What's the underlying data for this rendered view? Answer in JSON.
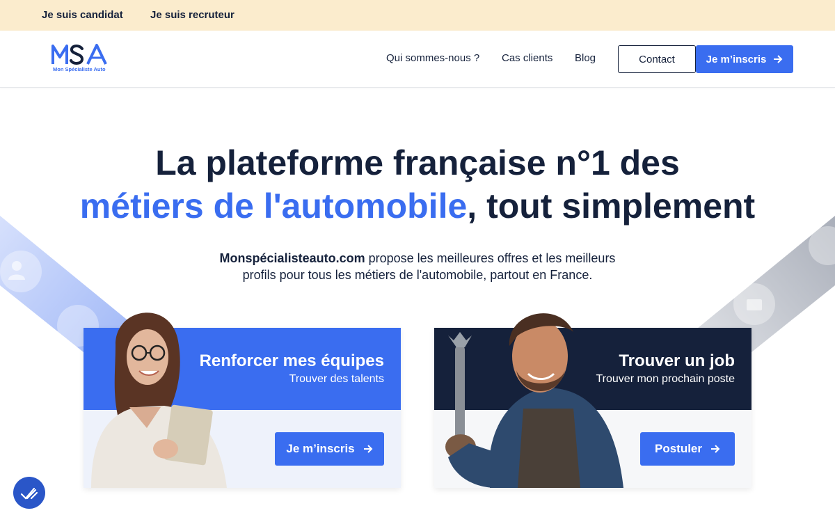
{
  "topbar": {
    "candidate_link": "Je suis candidat",
    "recruiter_link": "Je suis recruteur"
  },
  "header": {
    "logo_text": "MSA",
    "logo_tagline": "Mon Spécialiste Auto",
    "nav": [
      "Qui sommes-nous ?",
      "Cas clients",
      "Blog"
    ],
    "contact_label": "Contact",
    "signup_label": "Je m’inscris"
  },
  "hero": {
    "title_line1": "La plateforme française n°1 des",
    "title_accent": "métiers de l'automobile",
    "title_rest": ", tout simplement",
    "subtitle_bold": "Monspécialisteauto.com",
    "subtitle_line1_rest": " propose les meilleures offres et les meilleurs",
    "subtitle_line2": "profils pour tous les métiers de l'automobile, partout en France."
  },
  "cards": [
    {
      "title": "Renforcer mes équipes",
      "subtitle": "Trouver des talents",
      "button": "Je m’inscris"
    },
    {
      "title": "Trouver un job",
      "subtitle": "Trouver mon prochain poste",
      "button": "Postuler"
    }
  ],
  "colors": {
    "accent": "#3a6df0",
    "navy": "#15213b",
    "topbar": "#fbeccd"
  },
  "icons": {
    "arrow": "arrow-right-icon",
    "fab": "checkmark-icon"
  }
}
